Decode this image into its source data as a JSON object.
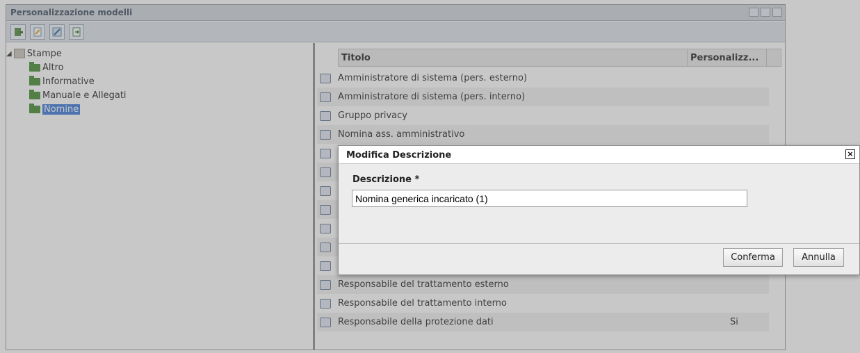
{
  "window": {
    "title": "Personalizzazione modelli"
  },
  "tree": {
    "root": {
      "label": "Stampe",
      "icon": "library-icon"
    },
    "items": [
      {
        "label": "Altro",
        "icon": "folder-icon",
        "selected": false
      },
      {
        "label": "Informative",
        "icon": "folder-icon",
        "selected": false
      },
      {
        "label": "Manuale e Allegati",
        "icon": "folder-icon",
        "selected": false
      },
      {
        "label": "Nomine",
        "icon": "folder-icon",
        "selected": true
      }
    ]
  },
  "grid": {
    "columns": {
      "title": "Titolo",
      "custom": "Personalizz..."
    },
    "rows": [
      {
        "title": "Amministratore di sistema (pers. esterno)",
        "custom": ""
      },
      {
        "title": "Amministratore di sistema (pers. interno)",
        "custom": ""
      },
      {
        "title": "Gruppo privacy",
        "custom": ""
      },
      {
        "title": "Nomina ass. amministrativo",
        "custom": ""
      },
      {
        "title": "",
        "custom": ""
      },
      {
        "title": "",
        "custom": ""
      },
      {
        "title": "",
        "custom": ""
      },
      {
        "title": "",
        "custom": ""
      },
      {
        "title": "",
        "custom": ""
      },
      {
        "title": "",
        "custom": ""
      },
      {
        "title": "",
        "custom": ""
      },
      {
        "title": "Responsabile del trattamento esterno",
        "custom": ""
      },
      {
        "title": "Responsabile del trattamento interno",
        "custom": ""
      },
      {
        "title": "Responsabile della protezione dati",
        "custom": "Si"
      }
    ]
  },
  "dialog": {
    "title": "Modifica Descrizione",
    "field_label": "Descrizione *",
    "field_value": "Nomina generica incaricato (1)",
    "confirm_label": "Conferma",
    "cancel_label": "Annulla",
    "close_glyph": "×"
  },
  "colors": {
    "selection": "#3875d7",
    "folder": "#3f8a2c",
    "titlebar": "#cfd6de"
  }
}
